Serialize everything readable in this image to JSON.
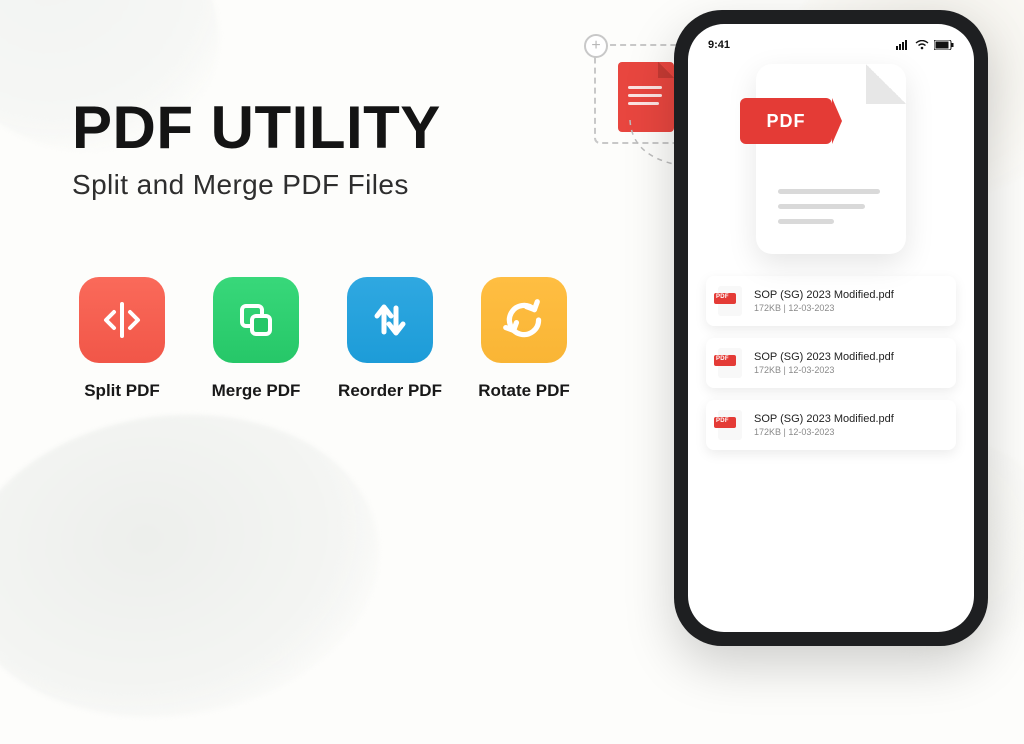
{
  "hero": {
    "title": "PDF UTILITY",
    "subtitle": "Split and Merge PDF Files"
  },
  "features": [
    {
      "id": "split",
      "label": "Split PDF",
      "color": "red"
    },
    {
      "id": "merge",
      "label": "Merge PDF",
      "color": "green"
    },
    {
      "id": "reorder",
      "label": "Reorder PDF",
      "color": "blue"
    },
    {
      "id": "rotate",
      "label": "Rotate PDF",
      "color": "yellow"
    }
  ],
  "phone": {
    "status_time": "9:41",
    "hero_badge": "PDF",
    "files": [
      {
        "name": "SOP (SG) 2023 Modified.pdf",
        "size": "172KB",
        "date": "12-03-2023"
      },
      {
        "name": "SOP (SG) 2023 Modified.pdf",
        "size": "172KB",
        "date": "12-03-2023"
      },
      {
        "name": "SOP (SG) 2023 Modified.pdf",
        "size": "172KB",
        "date": "12-03-2023"
      }
    ]
  },
  "colors": {
    "red": "#f15a4d",
    "green": "#2bce6f",
    "blue": "#22a1dc",
    "yellow": "#fab938",
    "pdf_red": "#e43b36"
  }
}
